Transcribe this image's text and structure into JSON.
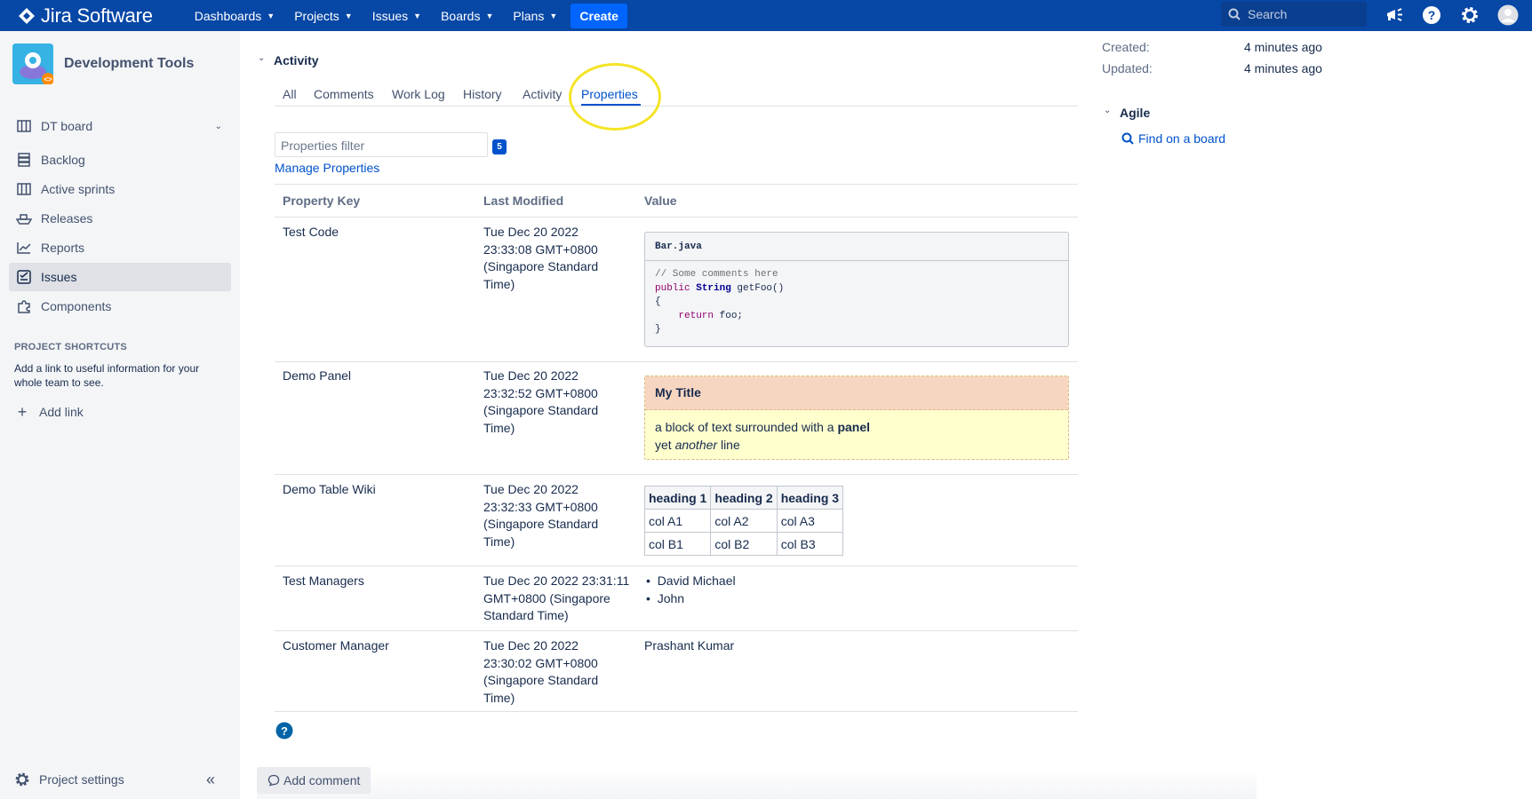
{
  "topbar": {
    "brand": "Jira Software",
    "nav": [
      "Dashboards",
      "Projects",
      "Issues",
      "Boards",
      "Plans"
    ],
    "create_label": "Create",
    "search_placeholder": "Search"
  },
  "sidebar": {
    "project_name": "Development Tools",
    "board_label": "DT board",
    "items": [
      "Backlog",
      "Active sprints",
      "Releases",
      "Reports",
      "Issues",
      "Components"
    ],
    "active_item": "Issues",
    "shortcuts_heading": "PROJECT SHORTCUTS",
    "shortcuts_desc": "Add a link to useful information for your whole team to see.",
    "add_link": "Add link",
    "project_settings": "Project settings"
  },
  "activity": {
    "title": "Activity",
    "tabs": [
      "All",
      "Comments",
      "Work Log",
      "History",
      "Activity",
      "Properties"
    ],
    "active_tab": "Properties",
    "filter_placeholder": "Properties filter",
    "count": "5",
    "manage_link": "Manage Properties",
    "headers": [
      "Property Key",
      "Last Modified",
      "Value"
    ]
  },
  "rows": {
    "r1": {
      "key": "Test Code",
      "modified": [
        "Tue Dec 20 2022",
        "23:33:08 GMT+0800",
        "(Singapore Standard",
        "Time)"
      ]
    },
    "r2": {
      "key": "Demo Panel",
      "modified": [
        "Tue Dec 20 2022",
        "23:32:52 GMT+0800",
        "(Singapore Standard",
        "Time)"
      ]
    },
    "r3": {
      "key": "Demo Table Wiki",
      "modified": [
        "Tue Dec 20 2022",
        "23:32:33 GMT+0800",
        "(Singapore Standard",
        "Time)"
      ]
    },
    "r4": {
      "key": "Test Managers",
      "modified": [
        "Tue Dec 20 2022 23:31:11",
        "GMT+0800 (Singapore",
        "Standard Time)"
      ]
    },
    "r5": {
      "key": "Customer Manager",
      "modified": [
        "Tue Dec 20 2022",
        "23:30:02 GMT+0800",
        "(Singapore Standard",
        "Time)"
      ]
    }
  },
  "code": {
    "filename": "Bar.java",
    "comment": "// Some comments here",
    "kw_public": "public",
    "kw_type": "String",
    "method": " getFoo()",
    "open": "{",
    "kw_return": "return",
    "ret_val": " foo;",
    "close": "}"
  },
  "panel": {
    "title": "My Title",
    "line1_pre": "a block of text surrounded with a ",
    "line1_bold": "panel",
    "line2_pre": "yet ",
    "line2_italic": "another",
    "line2_post": " line"
  },
  "wiki_table": {
    "headers": [
      "heading 1",
      "heading 2",
      "heading 3"
    ],
    "row_a": [
      "col A1",
      "col A2",
      "col A3"
    ],
    "row_b": [
      "col B1",
      "col B2",
      "col B3"
    ]
  },
  "managers": [
    "David Michael",
    "John"
  ],
  "customer_manager": "Prashant Kumar",
  "right": {
    "created_label": "Created:",
    "created_value": "4 minutes ago",
    "updated_label": "Updated:",
    "updated_value": "4 minutes ago",
    "agile_heading": "Agile",
    "find_board": "Find on a board"
  },
  "add_comment": "Add comment",
  "colors": {
    "topbar": "#0747a6",
    "link": "#0052cc",
    "highlight_circle": "#f4e425"
  }
}
